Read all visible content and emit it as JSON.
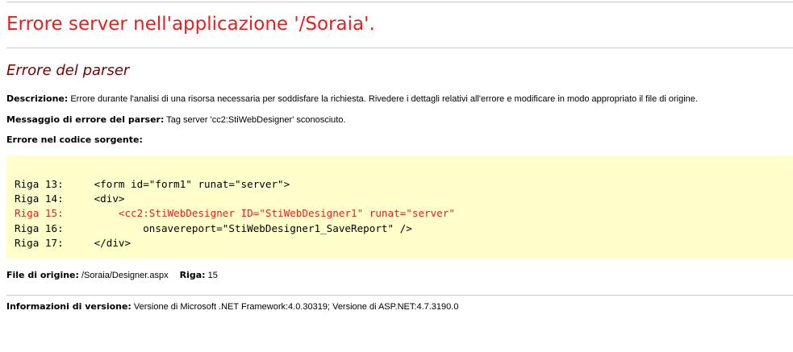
{
  "header": {
    "title": "Errore server nell'applicazione '/Soraia'.",
    "subtitle": "Errore del parser"
  },
  "description": {
    "label": "Descrizione:",
    "text": "Errore durante l'analisi di una risorsa necessaria per soddisfare la richiesta. Rivedere i dettagli relativi all'errore e modificare in modo appropriato il file di origine."
  },
  "parser_message": {
    "label": "Messaggio di errore del parser:",
    "text": "Tag server 'cc2:StiWebDesigner' sconosciuto."
  },
  "source": {
    "label": "Errore nel codice sorgente:",
    "lines": [
      {
        "text": "Riga 13:     <form id=\"form1\" runat=\"server\">",
        "error": false
      },
      {
        "text": "Riga 14:     <div>",
        "error": false
      },
      {
        "text": "Riga 15:         <cc2:StiWebDesigner ID=\"StiWebDesigner1\" runat=\"server\"",
        "error": true
      },
      {
        "text": "Riga 16:             onsavereport=\"StiWebDesigner1_SaveReport\" />",
        "error": false
      },
      {
        "text": "Riga 17:     </div>",
        "error": false
      }
    ]
  },
  "file": {
    "label": "File di origine:",
    "value": "/Soraia/Designer.aspx",
    "line_label": "Riga:",
    "line_value": "15"
  },
  "version": {
    "label": "Informazioni di versione:",
    "text": "Versione di Microsoft .NET Framework:4.0.30319; Versione di ASP.NET:4.7.3190.0"
  },
  "colors": {
    "title": "#e81f1f",
    "subtitle": "#7a0000",
    "error_line": "#e81f1f",
    "code_background": "#ffffcc",
    "rule": "#c8c8c8"
  }
}
